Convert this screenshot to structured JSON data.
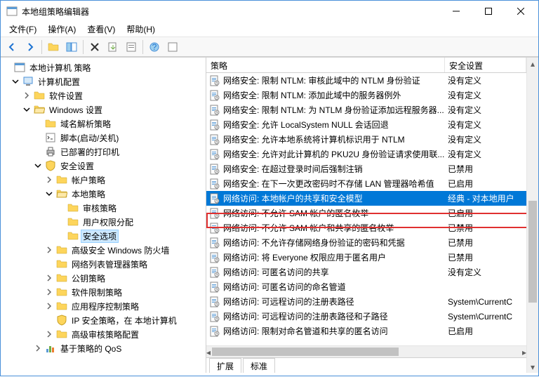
{
  "window": {
    "title": "本地组策略编辑器"
  },
  "menu": [
    "文件(F)",
    "操作(A)",
    "查看(V)",
    "帮助(H)"
  ],
  "tree_root": "本地计算机 策略",
  "tree_computer": "计算机配置",
  "tree_software": "软件设置",
  "tree_windows": "Windows 设置",
  "tree_dns": "域名解析策略",
  "tree_scripts": "脚本(启动/关机)",
  "tree_printers": "已部署的打印机",
  "tree_security": "安全设置",
  "tree_account": "帐户策略",
  "tree_local": "本地策略",
  "tree_audit": "审核策略",
  "tree_rights": "用户权限分配",
  "tree_secopt": "安全选项",
  "tree_firewall": "高级安全 Windows 防火墙",
  "tree_nlm": "网络列表管理器策略",
  "tree_pubkey": "公钥策略",
  "tree_swrestrict": "软件限制策略",
  "tree_appctrl": "应用程序控制策略",
  "tree_ipsec": "IP 安全策略，在 本地计算机",
  "tree_advaudit": "高级审核策略配置",
  "tree_qos": "基于策略的 QoS",
  "columns": {
    "policy": "策略",
    "setting": "安全设置"
  },
  "rows": [
    {
      "p": "网络安全: 限制 NTLM: 审核此域中的 NTLM 身份验证",
      "s": "没有定义"
    },
    {
      "p": "网络安全: 限制 NTLM: 添加此域中的服务器例外",
      "s": "没有定义"
    },
    {
      "p": "网络安全: 限制 NTLM: 为 NTLM 身份验证添加远程服务器...",
      "s": "没有定义"
    },
    {
      "p": "网络安全: 允许 LocalSystem NULL 会话回退",
      "s": "没有定义"
    },
    {
      "p": "网络安全: 允许本地系统将计算机标识用于 NTLM",
      "s": "没有定义"
    },
    {
      "p": "网络安全: 允许对此计算机的 PKU2U 身份验证请求使用联...",
      "s": "没有定义"
    },
    {
      "p": "网络安全: 在超过登录时间后强制注销",
      "s": "已禁用"
    },
    {
      "p": "网络安全: 在下一次更改密码时不存储 LAN 管理器哈希值",
      "s": "已启用"
    },
    {
      "p": "网络访问: 本地帐户的共享和安全模型",
      "s": "经典 - 对本地用户"
    },
    {
      "p": "网络访问: 不允许 SAM 帐户的匿名枚举",
      "s": "已启用"
    },
    {
      "p": "网络访问: 不允许 SAM 帐户和共享的匿名枚举",
      "s": "已禁用"
    },
    {
      "p": "网络访问: 不允许存储网络身份验证的密码和凭据",
      "s": "已禁用"
    },
    {
      "p": "网络访问: 将 Everyone 权限应用于匿名用户",
      "s": "已禁用"
    },
    {
      "p": "网络访问: 可匿名访问的共享",
      "s": "没有定义"
    },
    {
      "p": "网络访问: 可匿名访问的命名管道",
      "s": ""
    },
    {
      "p": "网络访问: 可远程访问的注册表路径",
      "s": "System\\CurrentC"
    },
    {
      "p": "网络访问: 可远程访问的注册表路径和子路径",
      "s": "System\\CurrentC"
    },
    {
      "p": "网络访问: 限制对命名管道和共享的匿名访问",
      "s": "已启用"
    }
  ],
  "tabs": [
    "扩展",
    "标准"
  ]
}
